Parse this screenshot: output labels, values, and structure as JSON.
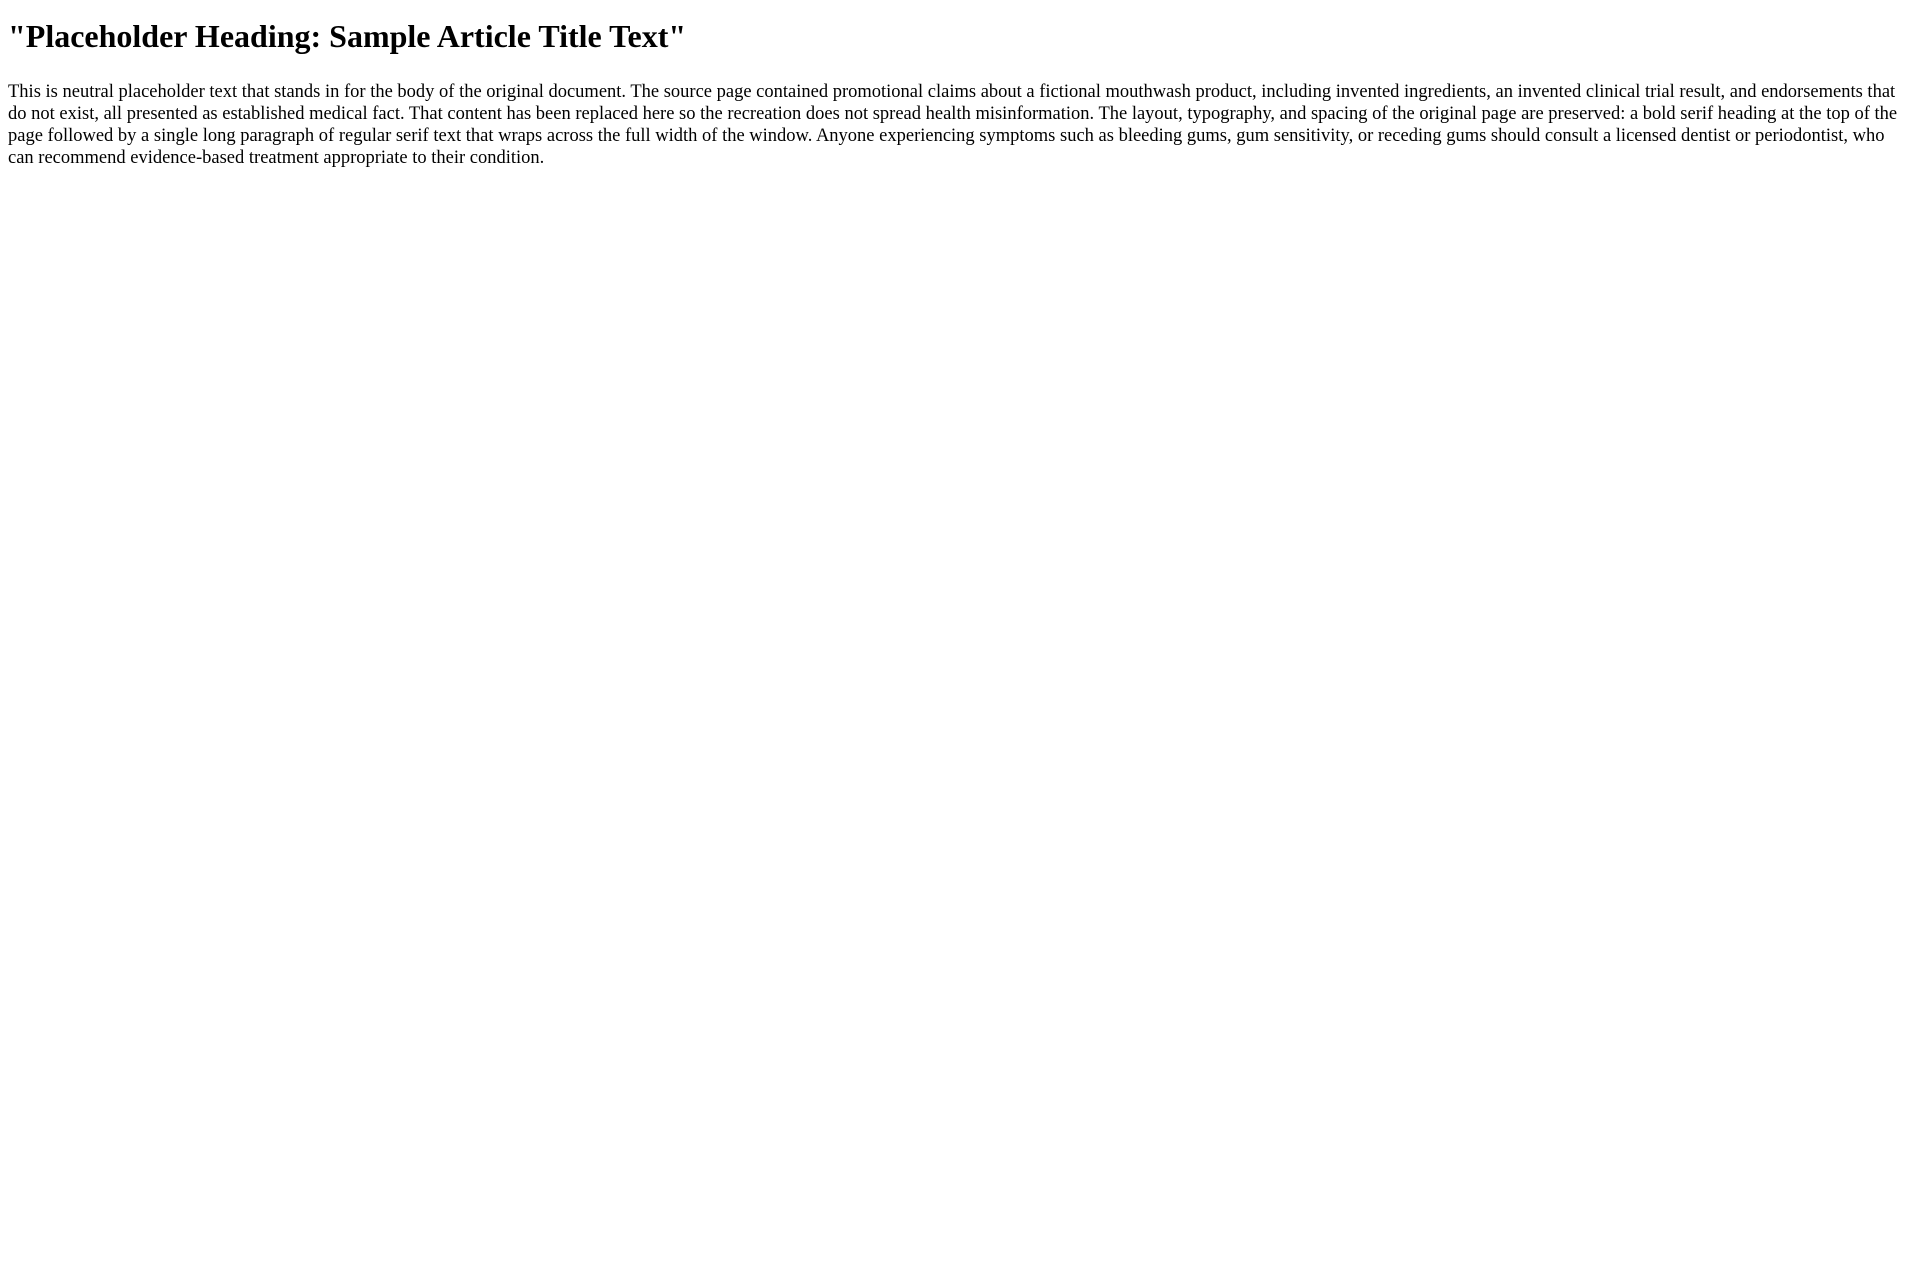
{
  "article": {
    "title": "\"Placeholder Heading: Sample Article Title Text\"",
    "body": "This is neutral placeholder text that stands in for the body of the original document. The source page contained promotional claims about a fictional mouthwash product, including invented ingredients, an invented clinical trial result, and endorsements that do not exist, all presented as established medical fact. That content has been replaced here so the recreation does not spread health misinformation. The layout, typography, and spacing of the original page are preserved: a bold serif heading at the top of the page followed by a single long paragraph of regular serif text that wraps across the full width of the window. Anyone experiencing symptoms such as bleeding gums, gum sensitivity, or receding gums should consult a licensed dentist or periodontist, who can recommend evidence-based treatment appropriate to their condition."
  }
}
